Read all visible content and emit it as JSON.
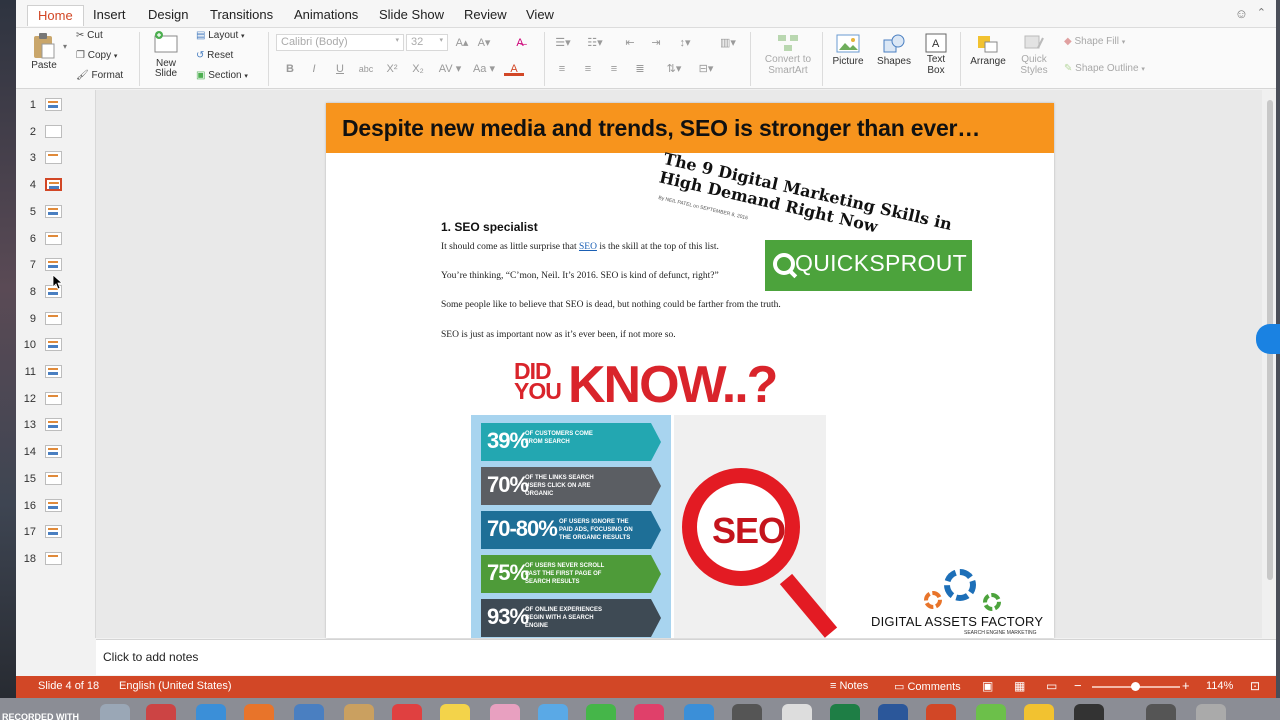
{
  "tabs": [
    "Home",
    "Insert",
    "Design",
    "Transitions",
    "Animations",
    "Slide Show",
    "Review",
    "View"
  ],
  "active_tab": "Home",
  "ribbon": {
    "paste": "Paste",
    "cut": "Cut",
    "copy": "Copy",
    "format": "Format",
    "new_slide_1": "New",
    "new_slide_2": "Slide",
    "layout": "Layout",
    "reset": "Reset",
    "section": "Section",
    "font_name": "Calibri (Body)",
    "font_size": "32",
    "convert_1": "Convert to",
    "convert_2": "SmartArt",
    "picture": "Picture",
    "shapes": "Shapes",
    "textbox_1": "Text",
    "textbox_2": "Box",
    "arrange": "Arrange",
    "quick_styles_1": "Quick",
    "quick_styles_2": "Styles",
    "shape_fill": "Shape Fill",
    "shape_outline": "Shape Outline"
  },
  "thumbnails": [
    "1",
    "2",
    "3",
    "4",
    "5",
    "6",
    "7",
    "8",
    "9",
    "10",
    "11",
    "12",
    "13",
    "14",
    "15",
    "16",
    "17",
    "18"
  ],
  "selected_slide": "4",
  "slide": {
    "headline": "Despite new media and trends, SEO is stronger than ever…",
    "article_title": "The 9 Digital Marketing Skills in High Demand Right Now",
    "article_byline": "By NEIL PATEL on SEPTEMBER 8, 2016",
    "section_heading": "1. SEO specialist",
    "para1_before": "It should come as little surprise that ",
    "para1_link": "SEO",
    "para1_after": " is the skill at the top of this list.",
    "para2": "You’re thinking, “C’mon, Neil. It’s 2016. SEO is kind of defunct, right?”",
    "para3": "Some people like to believe that SEO is dead, but nothing could be farther from the truth.",
    "para4": "SEO is just as important now as it’s ever been, if not more so.",
    "quicksprout": "QUICKSPROUT",
    "did_you": "DID YOU",
    "know": "KNOW..?",
    "stats": [
      {
        "pct": "39%",
        "label": "OF CUSTOMERS COME FROM SEARCH",
        "color": "#23a7b1"
      },
      {
        "pct": "70%",
        "label": "OF THE LINKS SEARCH USERS CLICK ON ARE ORGANIC",
        "color": "#5b5e63"
      },
      {
        "pct": "70-80%",
        "label": "OF USERS IGNORE THE PAID ADS, FOCUSING ON THE ORGANIC RESULTS",
        "color": "#1e6f97"
      },
      {
        "pct": "75%",
        "label": "OF USERS NEVER SCROLL PAST THE FIRST PAGE OF SEARCH RESULTS",
        "color": "#4e9b39"
      },
      {
        "pct": "93%",
        "label": "OF ONLINE EXPERIENCES BEGIN WITH A SEARCH ENGINE",
        "color": "#3e4a54"
      }
    ],
    "seo_badge": "SEO",
    "daf_name": "DIGITAL ASSETS FACTORY",
    "daf_tagline": "SEARCH ENGINE MARKETING"
  },
  "notes_placeholder": "Click to add notes",
  "status": {
    "slide_info": "Slide 4 of 18",
    "language": "English (United States)",
    "notes": "Notes",
    "comments": "Comments",
    "zoom": "114%"
  },
  "watermark": "RECORDED WITH",
  "colors": {
    "accent": "#d24726",
    "banner": "#f7941d",
    "quicksprout": "#4ca33c",
    "seo_red": "#e31b23"
  }
}
